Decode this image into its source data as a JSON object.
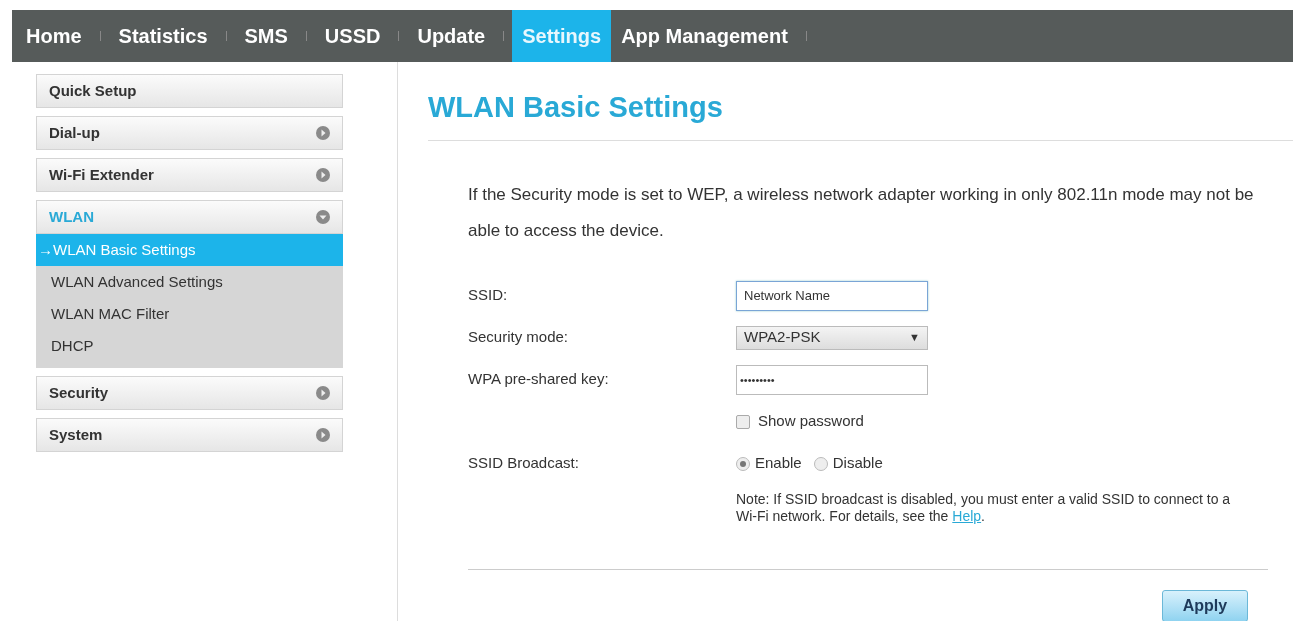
{
  "nav": [
    {
      "label": "Home",
      "selected": false
    },
    {
      "label": "Statistics",
      "selected": false
    },
    {
      "label": "SMS",
      "selected": false
    },
    {
      "label": "USSD",
      "selected": false
    },
    {
      "label": "Update",
      "selected": false
    },
    {
      "label": "Settings",
      "selected": true
    },
    {
      "label": "App Management",
      "selected": false
    }
  ],
  "sidebar": [
    {
      "label": "Quick Setup",
      "kind": "link"
    },
    {
      "label": "Dial-up",
      "kind": "group",
      "expanded": false
    },
    {
      "label": "Wi-Fi Extender",
      "kind": "group",
      "expanded": false
    },
    {
      "label": "WLAN",
      "kind": "group",
      "expanded": true,
      "children": [
        {
          "label": "WLAN Basic Settings",
          "selected": true,
          "marker": "→"
        },
        {
          "label": "WLAN Advanced Settings",
          "selected": false
        },
        {
          "label": "WLAN MAC Filter",
          "selected": false
        },
        {
          "label": "DHCP",
          "selected": false
        }
      ]
    },
    {
      "label": "Security",
      "kind": "group",
      "expanded": false
    },
    {
      "label": "System",
      "kind": "group",
      "expanded": false
    }
  ],
  "page_title": "WLAN Basic Settings",
  "intro": "If the Security mode is set to WEP, a wireless network adapter working in only 802.11n mode may not be able to access the device.",
  "form": [
    {
      "label": "SSID:",
      "kind": "text",
      "value": "Network Name"
    },
    {
      "label": "Security mode:",
      "kind": "select",
      "value": "WPA2-PSK",
      "caret": "▼"
    },
    {
      "label": "WPA pre-shared key:",
      "kind": "password",
      "value": "•••••••••"
    },
    {
      "kind": "checkbox",
      "label": "Show password",
      "checked": false
    },
    {
      "label": "SSID Broadcast:",
      "kind": "radio",
      "options": [
        {
          "label": "Enable",
          "selected": true
        },
        {
          "label": "Disable",
          "selected": false
        }
      ]
    }
  ],
  "note": {
    "text": "Note: If SSID broadcast is disabled, you must enter a valid SSID to connect to a Wi-Fi network. For details, see the ",
    "link": "Help",
    "after": "."
  },
  "apply_button": "Apply"
}
